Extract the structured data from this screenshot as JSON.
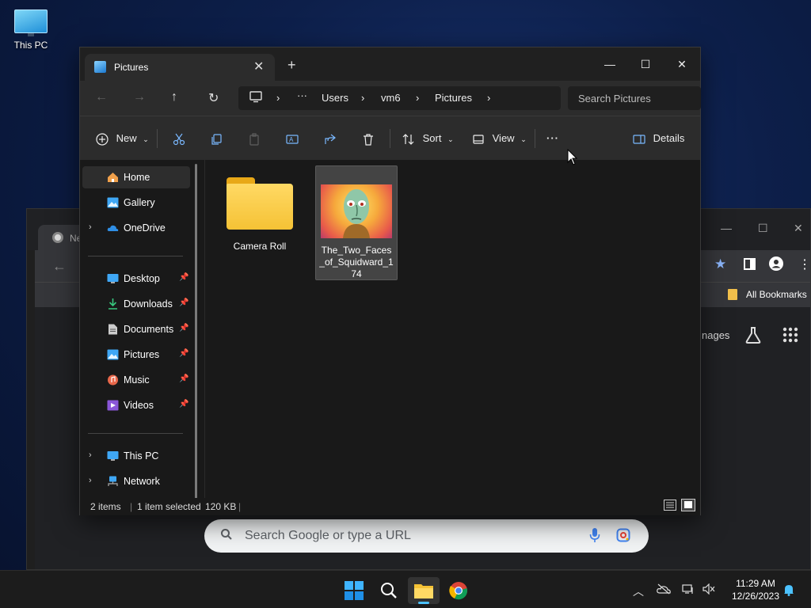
{
  "desktop": {
    "this_pc_label": "This PC"
  },
  "chrome": {
    "tab_title": "Ne",
    "bookmarks_label": "All Bookmarks",
    "images_link": "nages",
    "search_placeholder": "Search Google or type a URL"
  },
  "explorer": {
    "tab_title": "Pictures",
    "breadcrumb": [
      "Users",
      "vm6",
      "Pictures"
    ],
    "search_placeholder": "Search Pictures",
    "toolbar": {
      "new_label": "New",
      "sort_label": "Sort",
      "view_label": "View",
      "more_label": "···",
      "details_label": "Details"
    },
    "sidebar": {
      "items": [
        {
          "label": "Home",
          "icon": "home-icon"
        },
        {
          "label": "Gallery",
          "icon": "gallery-icon"
        },
        {
          "label": "OneDrive",
          "icon": "cloud-icon"
        },
        {
          "label": "Desktop",
          "icon": "desktop-icon"
        },
        {
          "label": "Downloads",
          "icon": "download-icon"
        },
        {
          "label": "Documents",
          "icon": "documents-icon"
        },
        {
          "label": "Pictures",
          "icon": "pictures-icon"
        },
        {
          "label": "Music",
          "icon": "music-icon"
        },
        {
          "label": "Videos",
          "icon": "videos-icon"
        },
        {
          "label": "This PC",
          "icon": "pc-icon"
        },
        {
          "label": "Network",
          "icon": "network-icon"
        }
      ]
    },
    "files": [
      {
        "name": "Camera Roll",
        "type": "folder"
      },
      {
        "name": "The_Two_Faces_of_Squidward_174",
        "type": "image"
      }
    ],
    "status": {
      "count": "2 items",
      "selected": "1 item selected",
      "size": "120 KB"
    }
  },
  "taskbar": {
    "time": "11:29 AM",
    "date": "12/26/2023"
  },
  "colors": {
    "accent": "#0078d4",
    "folder": "#f5c235"
  }
}
